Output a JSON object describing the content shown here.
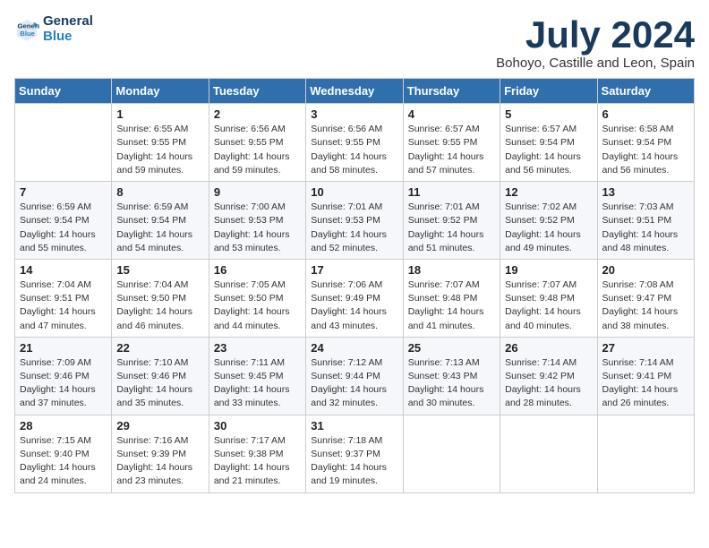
{
  "header": {
    "logo_line1": "General",
    "logo_line2": "Blue",
    "month_title": "July 2024",
    "subtitle": "Bohoyo, Castille and Leon, Spain"
  },
  "weekdays": [
    "Sunday",
    "Monday",
    "Tuesday",
    "Wednesday",
    "Thursday",
    "Friday",
    "Saturday"
  ],
  "weeks": [
    [
      {
        "day": "",
        "info": ""
      },
      {
        "day": "1",
        "info": "Sunrise: 6:55 AM\nSunset: 9:55 PM\nDaylight: 14 hours\nand 59 minutes."
      },
      {
        "day": "2",
        "info": "Sunrise: 6:56 AM\nSunset: 9:55 PM\nDaylight: 14 hours\nand 59 minutes."
      },
      {
        "day": "3",
        "info": "Sunrise: 6:56 AM\nSunset: 9:55 PM\nDaylight: 14 hours\nand 58 minutes."
      },
      {
        "day": "4",
        "info": "Sunrise: 6:57 AM\nSunset: 9:55 PM\nDaylight: 14 hours\nand 57 minutes."
      },
      {
        "day": "5",
        "info": "Sunrise: 6:57 AM\nSunset: 9:54 PM\nDaylight: 14 hours\nand 56 minutes."
      },
      {
        "day": "6",
        "info": "Sunrise: 6:58 AM\nSunset: 9:54 PM\nDaylight: 14 hours\nand 56 minutes."
      }
    ],
    [
      {
        "day": "7",
        "info": "Sunrise: 6:59 AM\nSunset: 9:54 PM\nDaylight: 14 hours\nand 55 minutes."
      },
      {
        "day": "8",
        "info": "Sunrise: 6:59 AM\nSunset: 9:54 PM\nDaylight: 14 hours\nand 54 minutes."
      },
      {
        "day": "9",
        "info": "Sunrise: 7:00 AM\nSunset: 9:53 PM\nDaylight: 14 hours\nand 53 minutes."
      },
      {
        "day": "10",
        "info": "Sunrise: 7:01 AM\nSunset: 9:53 PM\nDaylight: 14 hours\nand 52 minutes."
      },
      {
        "day": "11",
        "info": "Sunrise: 7:01 AM\nSunset: 9:52 PM\nDaylight: 14 hours\nand 51 minutes."
      },
      {
        "day": "12",
        "info": "Sunrise: 7:02 AM\nSunset: 9:52 PM\nDaylight: 14 hours\nand 49 minutes."
      },
      {
        "day": "13",
        "info": "Sunrise: 7:03 AM\nSunset: 9:51 PM\nDaylight: 14 hours\nand 48 minutes."
      }
    ],
    [
      {
        "day": "14",
        "info": "Sunrise: 7:04 AM\nSunset: 9:51 PM\nDaylight: 14 hours\nand 47 minutes."
      },
      {
        "day": "15",
        "info": "Sunrise: 7:04 AM\nSunset: 9:50 PM\nDaylight: 14 hours\nand 46 minutes."
      },
      {
        "day": "16",
        "info": "Sunrise: 7:05 AM\nSunset: 9:50 PM\nDaylight: 14 hours\nand 44 minutes."
      },
      {
        "day": "17",
        "info": "Sunrise: 7:06 AM\nSunset: 9:49 PM\nDaylight: 14 hours\nand 43 minutes."
      },
      {
        "day": "18",
        "info": "Sunrise: 7:07 AM\nSunset: 9:48 PM\nDaylight: 14 hours\nand 41 minutes."
      },
      {
        "day": "19",
        "info": "Sunrise: 7:07 AM\nSunset: 9:48 PM\nDaylight: 14 hours\nand 40 minutes."
      },
      {
        "day": "20",
        "info": "Sunrise: 7:08 AM\nSunset: 9:47 PM\nDaylight: 14 hours\nand 38 minutes."
      }
    ],
    [
      {
        "day": "21",
        "info": "Sunrise: 7:09 AM\nSunset: 9:46 PM\nDaylight: 14 hours\nand 37 minutes."
      },
      {
        "day": "22",
        "info": "Sunrise: 7:10 AM\nSunset: 9:46 PM\nDaylight: 14 hours\nand 35 minutes."
      },
      {
        "day": "23",
        "info": "Sunrise: 7:11 AM\nSunset: 9:45 PM\nDaylight: 14 hours\nand 33 minutes."
      },
      {
        "day": "24",
        "info": "Sunrise: 7:12 AM\nSunset: 9:44 PM\nDaylight: 14 hours\nand 32 minutes."
      },
      {
        "day": "25",
        "info": "Sunrise: 7:13 AM\nSunset: 9:43 PM\nDaylight: 14 hours\nand 30 minutes."
      },
      {
        "day": "26",
        "info": "Sunrise: 7:14 AM\nSunset: 9:42 PM\nDaylight: 14 hours\nand 28 minutes."
      },
      {
        "day": "27",
        "info": "Sunrise: 7:14 AM\nSunset: 9:41 PM\nDaylight: 14 hours\nand 26 minutes."
      }
    ],
    [
      {
        "day": "28",
        "info": "Sunrise: 7:15 AM\nSunset: 9:40 PM\nDaylight: 14 hours\nand 24 minutes."
      },
      {
        "day": "29",
        "info": "Sunrise: 7:16 AM\nSunset: 9:39 PM\nDaylight: 14 hours\nand 23 minutes."
      },
      {
        "day": "30",
        "info": "Sunrise: 7:17 AM\nSunset: 9:38 PM\nDaylight: 14 hours\nand 21 minutes."
      },
      {
        "day": "31",
        "info": "Sunrise: 7:18 AM\nSunset: 9:37 PM\nDaylight: 14 hours\nand 19 minutes."
      },
      {
        "day": "",
        "info": ""
      },
      {
        "day": "",
        "info": ""
      },
      {
        "day": "",
        "info": ""
      }
    ]
  ]
}
